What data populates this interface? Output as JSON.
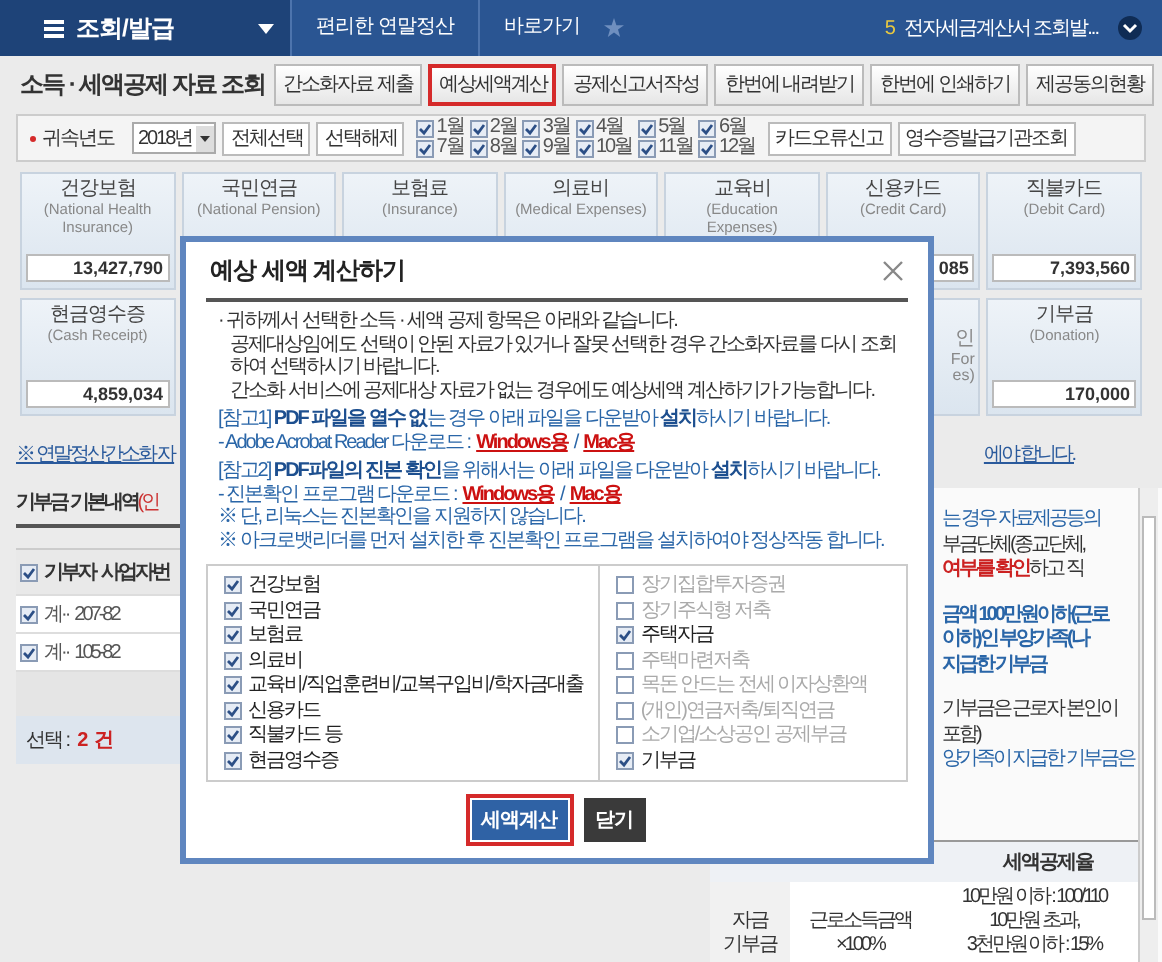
{
  "topbar": {
    "menu_label": "조회/발급",
    "breadcrumbs": [
      "편리한 연말정산",
      "바로가기"
    ],
    "notice_count": "5",
    "notice_text": "전자세금계산서 조회발..."
  },
  "page_title": "소득 · 세액공제 자료 조회",
  "actions": [
    {
      "label": "간소화자료 제출",
      "selected": false
    },
    {
      "label": "예상세액계산",
      "selected": true
    },
    {
      "label": "공제신고서작성",
      "selected": false
    },
    {
      "label": "한번에 내려받기",
      "selected": false
    },
    {
      "label": "한번에 인쇄하기",
      "selected": false
    },
    {
      "label": "제공동의현황",
      "selected": false
    }
  ],
  "filter": {
    "label": "귀속년도",
    "year": "2018년",
    "buttons": [
      "전체선택",
      "선택해제"
    ],
    "months": [
      {
        "label": "1월",
        "checked": true
      },
      {
        "label": "7월",
        "checked": true
      },
      {
        "label": "2월",
        "checked": true
      },
      {
        "label": "8월",
        "checked": true
      },
      {
        "label": "3월",
        "checked": true
      },
      {
        "label": "9월",
        "checked": true
      },
      {
        "label": "4월",
        "checked": true
      },
      {
        "label": "10월",
        "checked": true
      },
      {
        "label": "5월",
        "checked": true
      },
      {
        "label": "11월",
        "checked": true
      },
      {
        "label": "6월",
        "checked": true
      },
      {
        "label": "12월",
        "checked": true
      }
    ],
    "right_buttons": [
      "카드오류신고",
      "영수증발급기관조회"
    ]
  },
  "cards_row1": [
    {
      "kind": "full",
      "title": "건강보험",
      "subtitle": "(National Health Insurance)",
      "amount": "13,427,790"
    },
    {
      "kind": "header",
      "title": "국민연금",
      "subtitle": "(National Pension)"
    },
    {
      "kind": "header",
      "title": "보험료",
      "subtitle": "(Insurance)"
    },
    {
      "kind": "header",
      "title": "의료비",
      "subtitle": "(Medical Expenses)"
    },
    {
      "kind": "header",
      "title": "교육비",
      "subtitle": "(Education Expenses)"
    },
    {
      "kind": "full",
      "title": "신용카드",
      "subtitle": "(Credit Card)",
      "amount": "085"
    },
    {
      "kind": "full",
      "title": "직불카드",
      "subtitle": "(Debit Card)",
      "amount": "7,393,560"
    }
  ],
  "cards_row2": [
    {
      "kind": "full",
      "title": "현금영수증",
      "subtitle": "(Cash Receipt)",
      "amount": "4,859,034"
    },
    {
      "kind": "fragment",
      "lines": [
        "인",
        "For",
        "es)"
      ]
    },
    {
      "kind": "full",
      "title": "기부금",
      "subtitle": "(Donation)",
      "amount": "170,000"
    }
  ],
  "notice_left": "※ 연말정산간소화 자",
  "notice_right": "에야 합니다.",
  "donation": {
    "title": "기부금 기본내역",
    "title_suffix": "(인",
    "header_checked": true,
    "columns": [
      "기부자",
      "사업자번"
    ],
    "rows": [
      {
        "checked": true,
        "cells": [
          "계··",
          "207-82"
        ]
      },
      {
        "checked": true,
        "cells": [
          "계··",
          "105-82"
        ]
      }
    ],
    "selected_label": "선택 :",
    "selected_count": "2 건"
  },
  "info_lines": [
    [
      {
        "text": "는 경우 자료제공등의",
        "kind": "blue"
      }
    ],
    [
      {
        "text": "부금단체(종교단체,",
        "kind": "dark"
      }
    ],
    [
      {
        "text": "여부를 확인",
        "kind": "red"
      },
      {
        "text": "하고 직",
        "kind": "dark"
      }
    ],
    [
      {
        "text": "금액 100만원이하(근로",
        "kind": "bluebold"
      }
    ],
    [
      {
        "text": "이하)인 부양가족(나",
        "kind": "bluebold"
      }
    ],
    [
      {
        "text": "지급한 기부금",
        "kind": "bluebold"
      }
    ],
    [
      {
        "text": "기부금은 근로자 본인이",
        "kind": "dark"
      }
    ],
    [
      {
        "text": "포함)",
        "kind": "dark"
      }
    ],
    [
      {
        "text": "양가족이 지급한 기부금은",
        "kind": "blue"
      }
    ]
  ],
  "rate_table": {
    "header": "세액공제율",
    "col1": [
      "자금",
      "기부금"
    ],
    "col2": "근로소득금액×100%",
    "col3": [
      "10만원 이하 : 100/110",
      "10만원 초과,",
      "3천만원 이하 : 15%"
    ]
  },
  "modal": {
    "title": "예상 세액 계산하기",
    "notes": [
      {
        "kind": "plain",
        "text": "· 귀하께서 선택한 소득 · 세액 공제 항목은 아래와 같습니다."
      },
      {
        "kind": "indent",
        "text": "공제대상임에도 선택이 안된 자료가 있거나 잘못 선택한 경우 간소화자료를 다시 조회하여 선택하시기 바랍니다."
      },
      {
        "kind": "indent",
        "text": "간소화 서비스에 공제대상 자료가 없는 경우에도 예상세액 계산하기가 가능합니다."
      },
      {
        "kind": "ref",
        "text": "[참고1] **PDF 파일을 열수 없**는 경우  아래 파일을 다운받아 **설치**하시기 바랍니다."
      },
      {
        "kind": "download",
        "text": "- Adobe Acrobat Reader 다운로드 :",
        "links": [
          "Windows용",
          "Mac용"
        ],
        "sep": "/"
      },
      {
        "kind": "ref",
        "text": "[참고2] **PDF파일의 진본 확인**을 위해서는 아래 파일을 다운받아 **설치**하시기 바랍니다."
      },
      {
        "kind": "download",
        "text": "- 진본확인 프로그램 다운로드 :",
        "links": [
          "Windows용",
          "Mac용"
        ],
        "sep": "/"
      },
      {
        "kind": "remark",
        "text": "※ 단, 리눅스는 진본확인을 지원하지 않습니다."
      },
      {
        "kind": "remark",
        "text": "※ 아크로뱃리더를 먼저 설치한 후 진본확인 프로그램을 설치하여야 정상작동 합니다."
      }
    ],
    "left_items": [
      {
        "label": "건강보험",
        "checked": true
      },
      {
        "label": "국민연금",
        "checked": true
      },
      {
        "label": "보험료",
        "checked": true
      },
      {
        "label": "의료비",
        "checked": true
      },
      {
        "label": "교육비/직업훈련비/교복구입비/학자금대출",
        "checked": true
      },
      {
        "label": "신용카드",
        "checked": true
      },
      {
        "label": "직불카드 등",
        "checked": true
      },
      {
        "label": "현금영수증",
        "checked": true
      }
    ],
    "right_items": [
      {
        "label": "장기집합투자증권",
        "checked": false
      },
      {
        "label": "장기주식형 저축",
        "checked": false
      },
      {
        "label": "주택자금",
        "checked": true
      },
      {
        "label": "주택마련저축",
        "checked": false
      },
      {
        "label": "목돈 안드는 전세 이자상환액",
        "checked": false
      },
      {
        "label": "(개인)연금저축/퇴직연금",
        "checked": false
      },
      {
        "label": "소기업/소상공인 공제부금",
        "checked": false
      },
      {
        "label": "기부금",
        "checked": true
      }
    ],
    "buttons": [
      {
        "label": "세액계산",
        "kind": "primary",
        "selected": true
      },
      {
        "label": "닫기",
        "kind": "dark",
        "selected": false
      }
    ]
  }
}
